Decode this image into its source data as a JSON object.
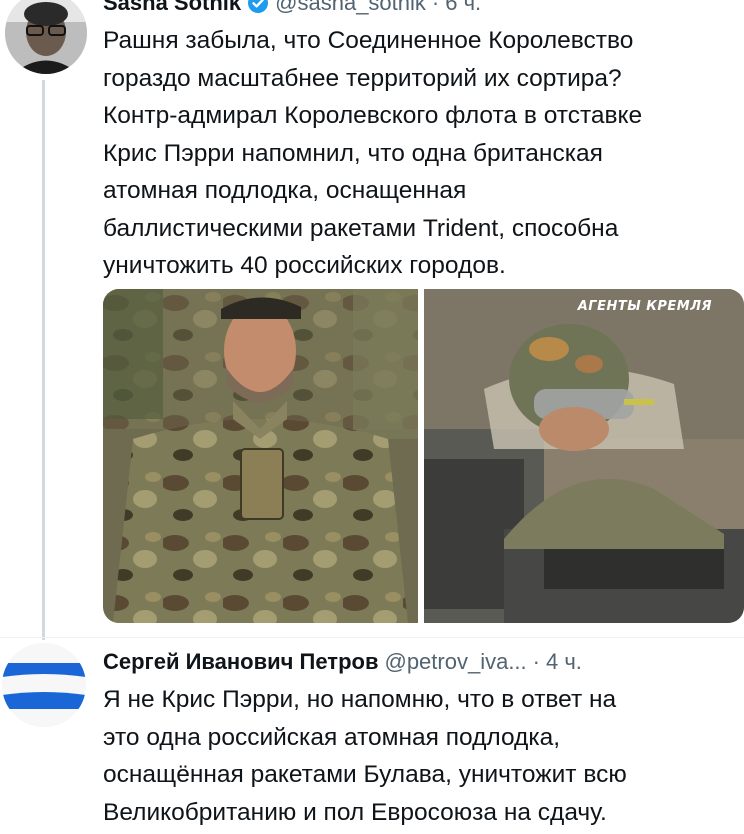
{
  "tweet1": {
    "author_name": "Sasha Sotnik",
    "handle": "@sasha_sotnik",
    "separator": "·",
    "time": "6 ч.",
    "text": "Рашня забыла, что Соединенное Королевство\nгораздо масштабнее территорий их сортира?\nКонтр-адмирал Королевского флота в отставке\nКрис Пэрри напомнил, что одна британская\nатомная подлодка, оснащенная\nбаллистическими ракетами Trident, способна\nуничтожить 40 российских городов.",
    "photo2_watermark": "АГЕНТЫ КРЕМЛЯ"
  },
  "tweet2": {
    "author_name": "Сергей Иванович Петров",
    "handle": "@petrov_iva...",
    "separator": "·",
    "time": "4 ч.",
    "text": "Я не Крис Пэрри, но напомню, что в ответ на\nэто одна российская атомная подлодка,\nоснащённая ракетами Булава, уничтожит всю\nВеликобританию и пол Евросоюза на сдачу."
  },
  "colors": {
    "text": "#0f1419",
    "secondary": "#536471",
    "verified": "#1d9bf0",
    "thread_line": "#cfd9de"
  },
  "icons": [
    "verified-badge-icon"
  ]
}
